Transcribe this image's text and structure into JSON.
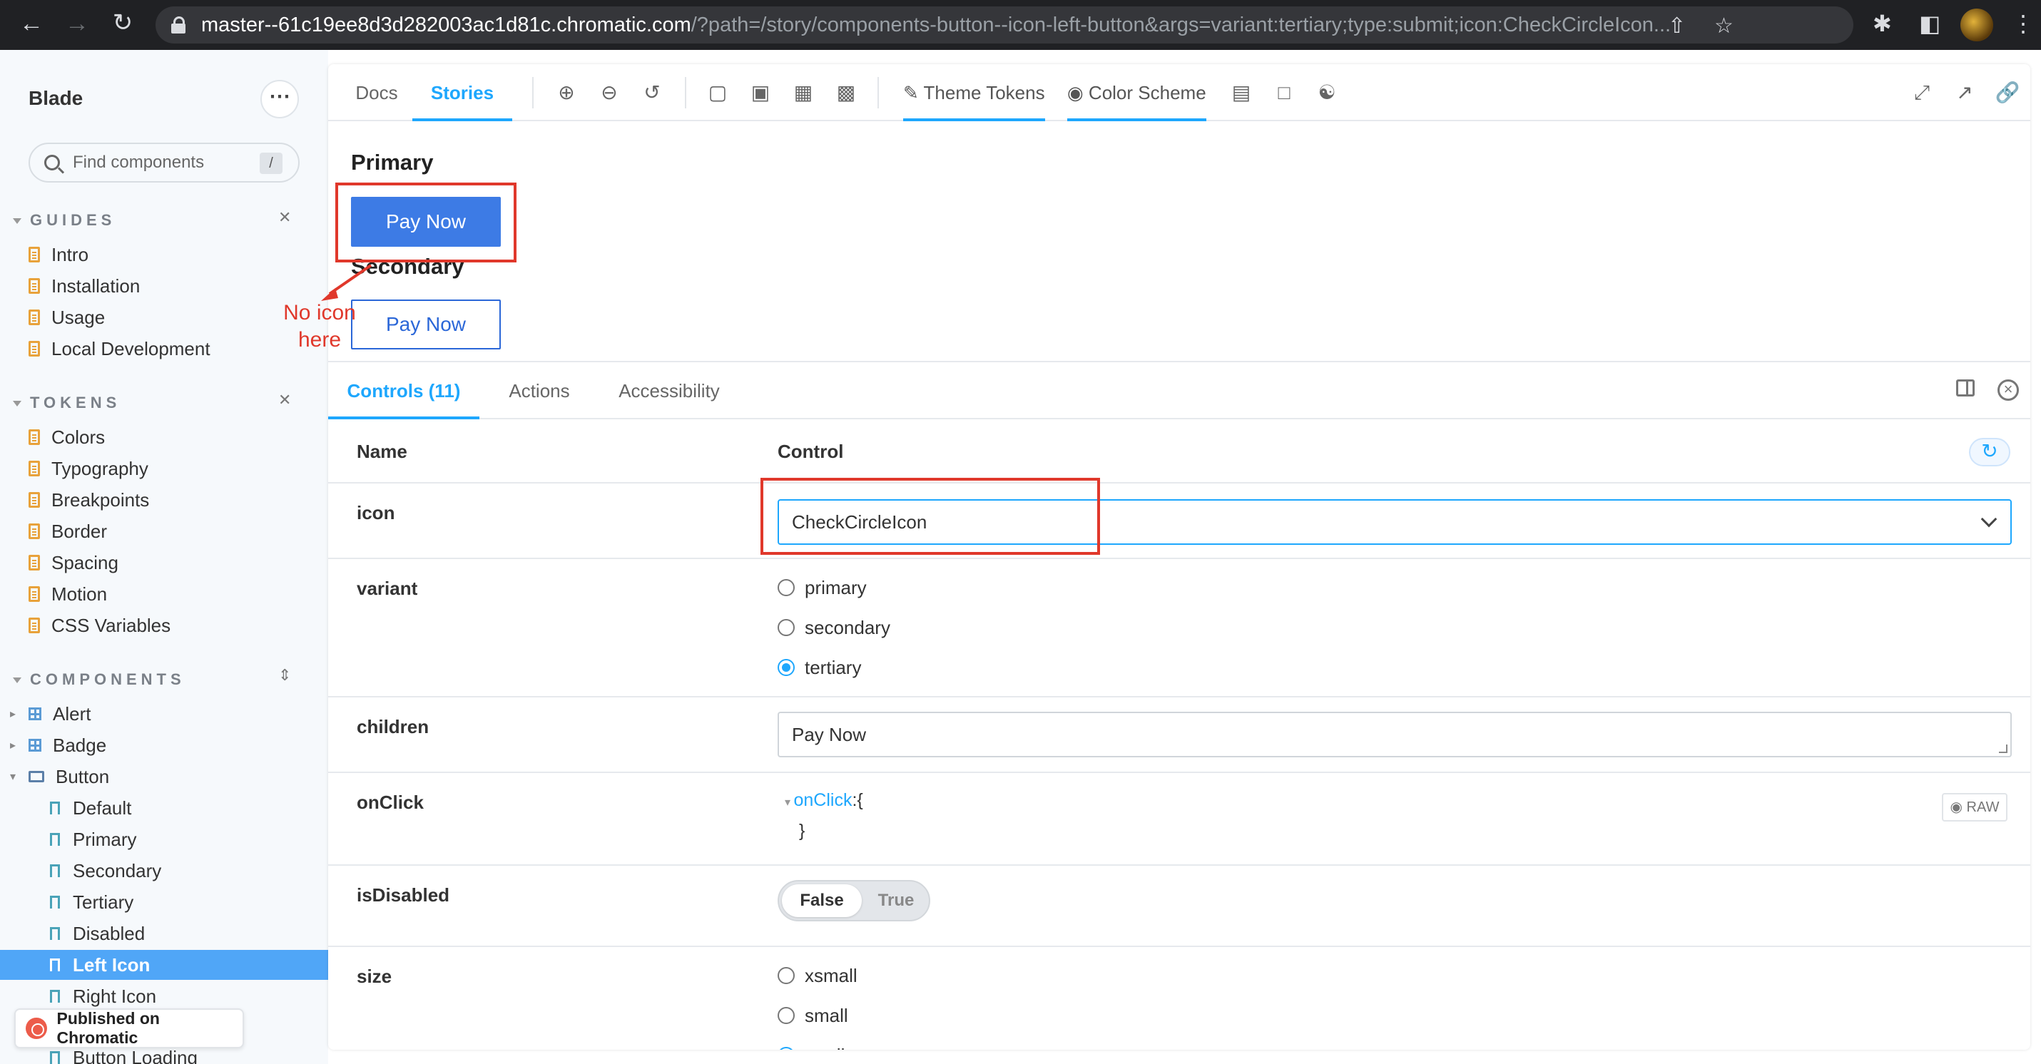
{
  "browser": {
    "url_host": "master--61c19ee8d3d282003ac1d81c.chromatic.com",
    "url_path": "/?path=/story/components-button--icon-left-button&args=variant:tertiary;type:submit;icon:CheckCircleIcon..."
  },
  "sidebar": {
    "brand": "Blade",
    "search_placeholder": "Find components",
    "search_shortcut": "/",
    "sections": [
      {
        "title": "GUIDES",
        "items": [
          "Intro",
          "Installation",
          "Usage",
          "Local Development"
        ]
      },
      {
        "title": "TOKENS",
        "items": [
          "Colors",
          "Typography",
          "Breakpoints",
          "Border",
          "Spacing",
          "Motion",
          "CSS Variables"
        ]
      },
      {
        "title": "COMPONENTS",
        "items": [
          "Alert",
          "Badge",
          "Button"
        ]
      }
    ],
    "button_stories": [
      "Default",
      "Primary",
      "Secondary",
      "Tertiary",
      "Disabled",
      "Left Icon",
      "Right Icon",
      "Button Loading"
    ],
    "active_story": "Left Icon",
    "published_badge": "Published on Chromatic"
  },
  "toolbar": {
    "tabs": [
      "Docs",
      "Stories"
    ],
    "active_tab": "Stories",
    "theme_tokens": "Theme Tokens",
    "color_scheme": "Color Scheme"
  },
  "canvas": {
    "primary_label": "Primary",
    "primary_button": "Pay Now",
    "secondary_label": "Secondary",
    "secondary_button": "Pay Now",
    "annotation": "No icon here"
  },
  "addons": {
    "tabs": [
      "Controls (11)",
      "Actions",
      "Accessibility"
    ],
    "active_tab": "Controls (11)",
    "col_name": "Name",
    "col_control": "Control",
    "rows": {
      "icon": {
        "name": "icon",
        "value": "CheckCircleIcon"
      },
      "variant": {
        "name": "variant",
        "options": [
          "primary",
          "secondary",
          "tertiary"
        ],
        "selected": "tertiary"
      },
      "children": {
        "name": "children",
        "value": "Pay Now"
      },
      "onClick": {
        "name": "onClick",
        "key": "onClick",
        "open": ":{",
        "close": "}",
        "raw_label": "RAW"
      },
      "isDisabled": {
        "name": "isDisabled",
        "on": "False",
        "off": "True"
      },
      "size": {
        "name": "size",
        "options": [
          "xsmall",
          "small",
          "medium"
        ],
        "selected": "medium"
      }
    }
  }
}
